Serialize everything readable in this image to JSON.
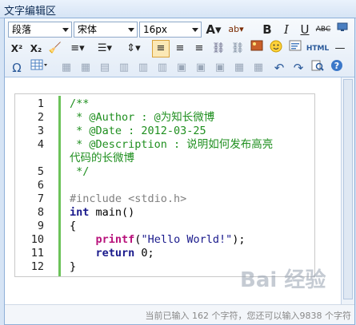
{
  "panel": {
    "title": "文字编辑区"
  },
  "toolbar": {
    "paragraph": "段落",
    "font": "宋体",
    "size": "16px",
    "bold": "B",
    "italic": "I",
    "underline": "U",
    "strike": "ABC",
    "superscript": "X²",
    "subscript": "X₂",
    "html": "HTML",
    "omega": "Ω"
  },
  "code": {
    "lines": [
      {
        "n": "1",
        "text": "/**"
      },
      {
        "n": "2",
        "text": " * @Author : @为知长微博"
      },
      {
        "n": "3",
        "text": " * @Date : 2012-03-25"
      },
      {
        "n": "4",
        "text": " * @Description : 说明如何发布高亮"
      },
      {
        "n": "",
        "text": "代码的长微博"
      },
      {
        "n": "5",
        "text": " */"
      },
      {
        "n": "6",
        "text": ""
      },
      {
        "n": "7",
        "text": "#include <stdio.h>"
      },
      {
        "n": "8",
        "text": "int main()"
      },
      {
        "n": "9",
        "text": "{"
      },
      {
        "n": "10",
        "text": "    printf(\"Hello World!\");"
      },
      {
        "n": "11",
        "text": "    return 0;"
      },
      {
        "n": "12",
        "text": "}"
      }
    ]
  },
  "status": {
    "text": "当前已输入 162 个字符，您还可以输入9838 个字符"
  },
  "watermark": {
    "text": "Bai 经验"
  }
}
